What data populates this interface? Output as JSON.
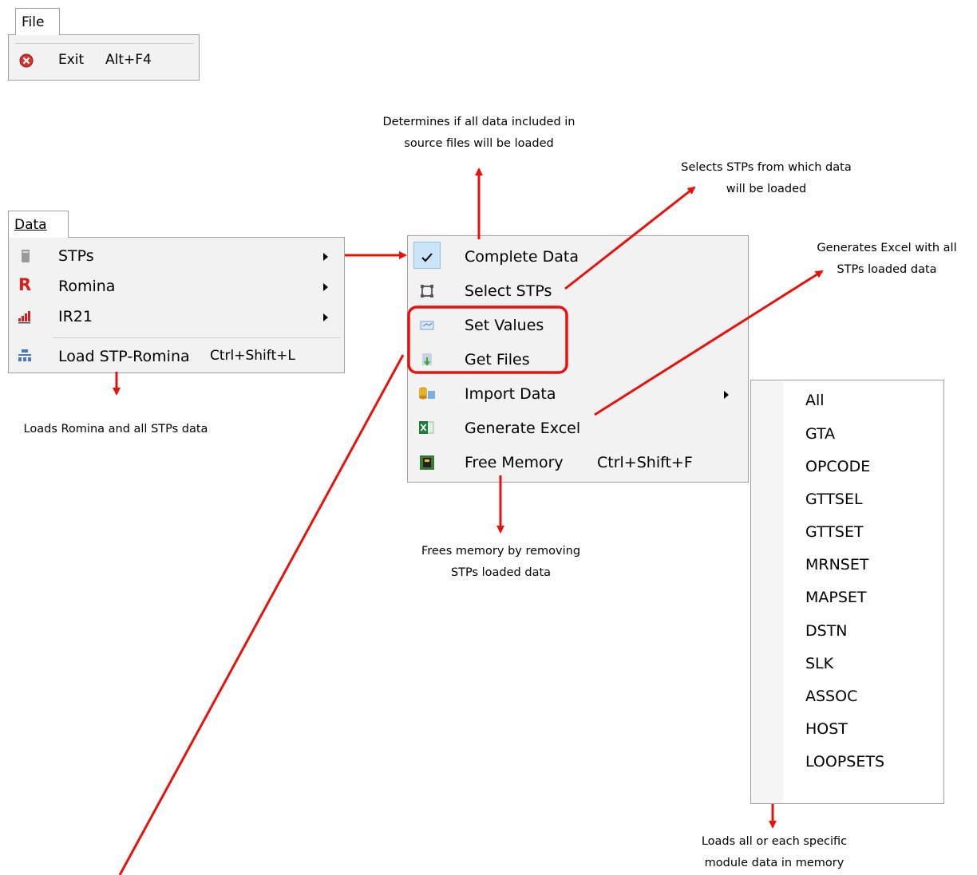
{
  "file_menu": {
    "header": "File",
    "items": [
      {
        "icon": "exit-icon",
        "label": "Exit",
        "shortcut": "Alt+F4"
      }
    ]
  },
  "data_menu": {
    "header": "Data",
    "items": [
      {
        "icon": "server-icon",
        "label": "STPs",
        "has_submenu": true
      },
      {
        "icon": "romina-r-icon",
        "label": "Romina",
        "has_submenu": true
      },
      {
        "icon": "ir21-bars-icon",
        "label": "IR21",
        "has_submenu": true
      },
      {
        "icon": "hierarchy-icon",
        "label": "Load STP-Romina",
        "shortcut": "Ctrl+Shift+L"
      }
    ]
  },
  "stps_submenu": {
    "items": [
      {
        "icon": "checkmark-icon",
        "label": "Complete Data",
        "checked": true
      },
      {
        "icon": "selection-icon",
        "label": "Select STPs"
      },
      {
        "icon": "set-values-icon",
        "label": "Set Values"
      },
      {
        "icon": "get-files-icon",
        "label": "Get Files"
      },
      {
        "icon": "database-icon",
        "label": "Import Data",
        "has_submenu": true
      },
      {
        "icon": "excel-icon",
        "label": "Generate Excel"
      },
      {
        "icon": "memory-icon",
        "label": "Free Memory",
        "shortcut": "Ctrl+Shift+F"
      }
    ]
  },
  "import_submenu": {
    "items": [
      "All",
      "GTA",
      "OPCODE",
      "GTTSEL",
      "GTTSET",
      "MRNSET",
      "MAPSET",
      "DSTN",
      "SLK",
      "ASSOC",
      "HOST",
      "LOOPSETS"
    ]
  },
  "annotations": {
    "complete_data": [
      "Determines if all data included in",
      "source files will be loaded"
    ],
    "select_stps": [
      "Selects STPs from which data",
      "will be loaded"
    ],
    "generate_excel": [
      "Generates Excel with all",
      "STPs loaded data"
    ],
    "load_stp_romina": "Loads Romina and all STPs data",
    "free_memory": [
      "Frees memory by removing",
      "STPs loaded data"
    ],
    "import_data": [
      "Loads all or each specific",
      "module data in memory"
    ]
  },
  "colors": {
    "arrow": "#e8120c",
    "highlight": "#e8120c",
    "check_bg": "#cce4f7"
  }
}
